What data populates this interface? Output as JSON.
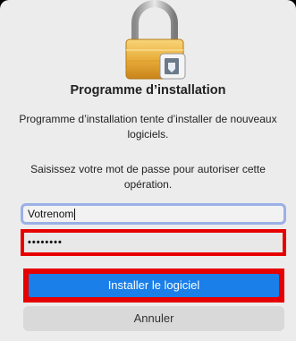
{
  "dialog": {
    "title": "Programme d’installation",
    "message": "Programme d’installation tente d’installer de nouveaux logiciels.",
    "prompt": "Saisissez votre mot de passe pour autoriser cette opération.",
    "username_value": "Votrenom",
    "password_value": "••••••••",
    "install_label": "Installer le logiciel",
    "cancel_label": "Annuler",
    "icon": "lock-icon",
    "accent_color": "#1a7fe8",
    "highlight_color": "#e60000"
  }
}
